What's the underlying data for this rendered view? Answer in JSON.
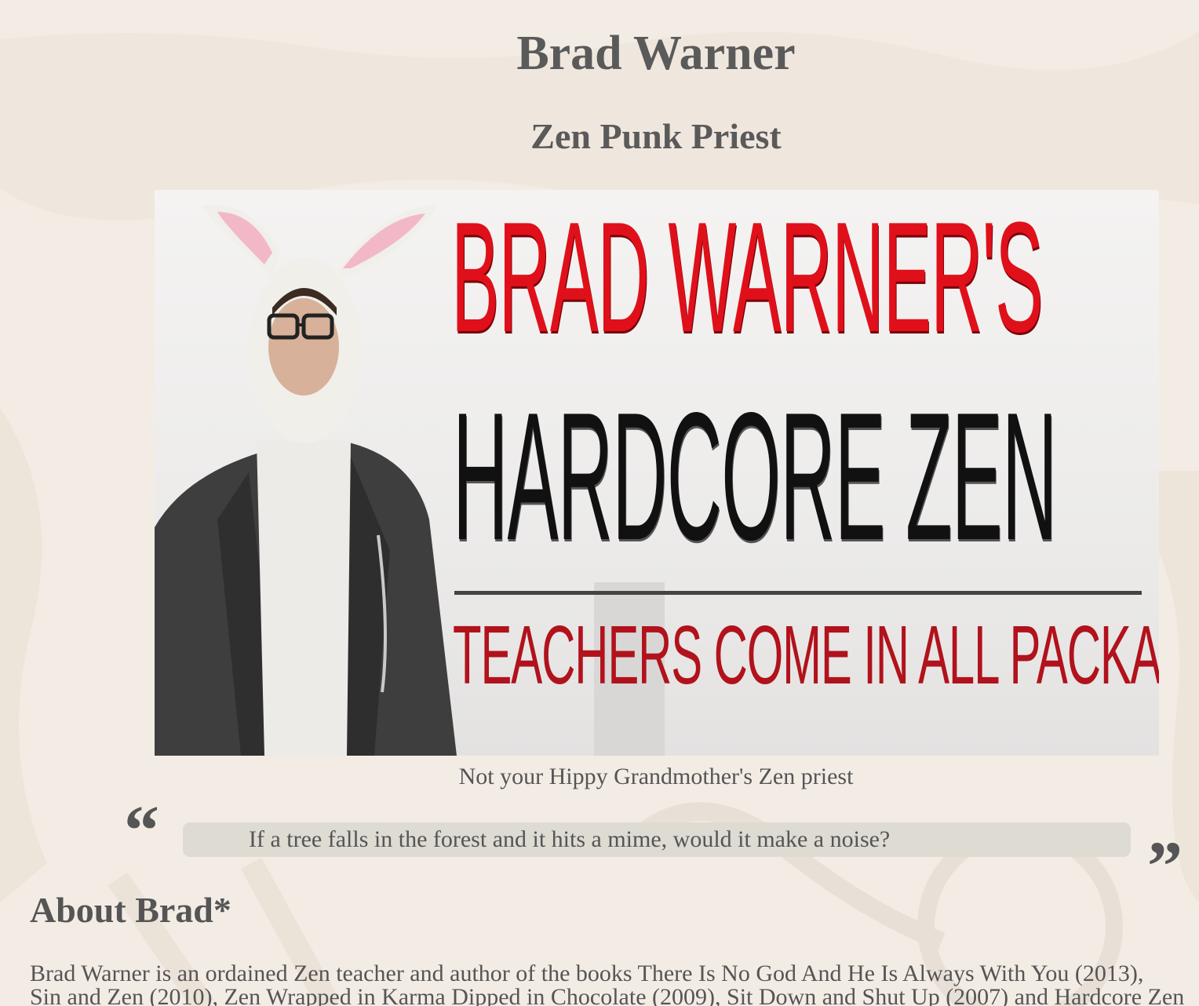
{
  "header": {
    "title": "Brad Warner",
    "subtitle": "Zen Punk Priest"
  },
  "banner": {
    "line1": "BRAD WARNER'S",
    "line2": "HARDCORE ZEN",
    "line3": "TEACHERS COME IN ALL PACKAGES",
    "colors": {
      "line1": "#e0101a",
      "line2": "#111111",
      "line3": "#b1121c"
    }
  },
  "caption": "Not your Hippy Grandmother's Zen priest",
  "quote": {
    "open_mark": "“",
    "text": "If a tree falls in the forest and it hits a mime, would it make a noise?",
    "close_mark": "”"
  },
  "about": {
    "heading": "About Brad*",
    "line1": "Brad Warner is an ordained Zen teacher and author of the books There Is No God And He Is Always With You (2013),",
    "line2": "Sin and Zen (2010), Zen Wrapped in Karma Dipped in Chocolate (2009), Sit Down and Shut Up (2007) and Hardcore Zen"
  },
  "colors": {
    "background": "#f3ece4",
    "text": "#555555",
    "quote_box": "#dedbd3"
  }
}
